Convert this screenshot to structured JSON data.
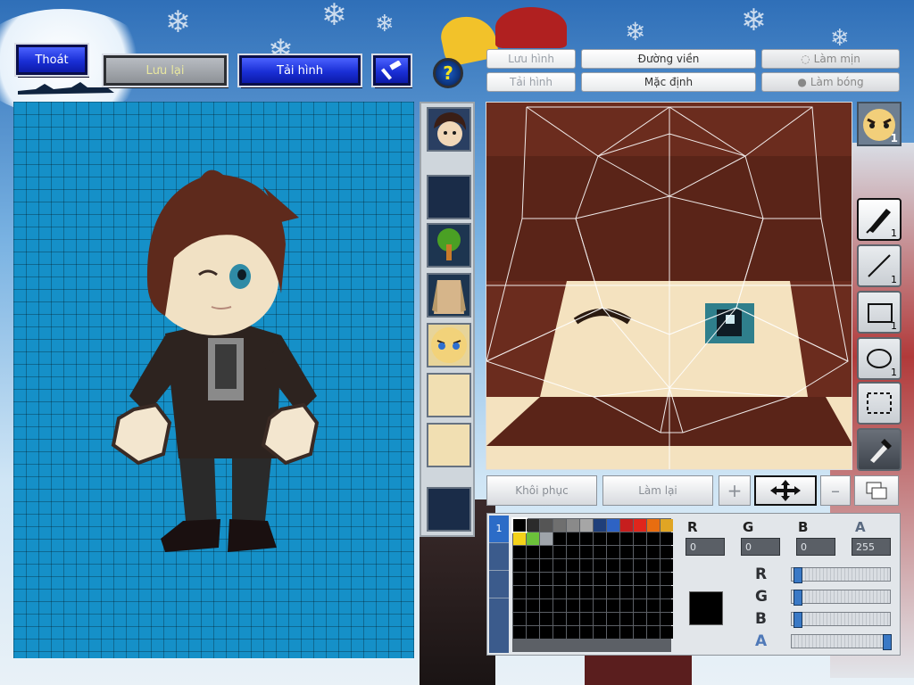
{
  "toolbar": {
    "exit_label": "Thoát",
    "save_label": "Lưu lại",
    "reload_label": "Tải hình",
    "help_symbol": "?"
  },
  "editor_tabs": {
    "save_image": "Lưu hình",
    "load_image": "Tải hình",
    "outline": "Đường viền",
    "default": "Mặc định",
    "smooth": "Làm mịn",
    "shadow": "Làm bóng"
  },
  "parts": [
    {
      "name": "face-portrait",
      "color": "#2a3f62"
    },
    {
      "name": "empty-slot",
      "color": "#162844"
    },
    {
      "name": "tree-item",
      "color": "#1d3550"
    },
    {
      "name": "jacket-item",
      "color": "#1d3550"
    },
    {
      "name": "face-angry",
      "color": "#e7d49a"
    },
    {
      "name": "face-skin",
      "color": "#f1dfb2"
    },
    {
      "name": "face-skin-2",
      "color": "#f1dfb2"
    },
    {
      "name": "empty-slot-2",
      "color": "#162844"
    }
  ],
  "tools": [
    {
      "name": "pen-tool",
      "count": "1"
    },
    {
      "name": "line-tool",
      "count": "1"
    },
    {
      "name": "rect-tool",
      "count": "1"
    },
    {
      "name": "ellipse-tool",
      "count": "1"
    },
    {
      "name": "select-tool",
      "count": ""
    },
    {
      "name": "eyedropper-tool",
      "count": ""
    }
  ],
  "expression_badge": "1",
  "actions": {
    "restore": "Khôi phục",
    "redo": "Làm lại"
  },
  "color_channels": {
    "headers": [
      "R",
      "G",
      "B",
      "A"
    ],
    "values": [
      "0",
      "0",
      "0",
      "255"
    ],
    "slider_labels": [
      "R",
      "G",
      "B",
      "A"
    ],
    "slider_levels": [
      0.02,
      0.02,
      0.02,
      1.0
    ]
  },
  "palette": {
    "row1": [
      "#000000",
      "#2b2b2b",
      "#555555",
      "#6f6f6f",
      "#8a8a8a",
      "#a6a6a6",
      "#1f3f7a",
      "#2e63c4",
      "#c61e1e",
      "#e0261c",
      "#e86d10",
      "#e0a524"
    ],
    "row2": [
      "#f4d21a",
      "#6bc13a",
      "#9fa4aa",
      "#000000",
      "#000000",
      "#000000",
      "#000000",
      "#000000",
      "#000000",
      "#000000",
      "#000000",
      "#000000"
    ],
    "selected_color": "#000000"
  }
}
